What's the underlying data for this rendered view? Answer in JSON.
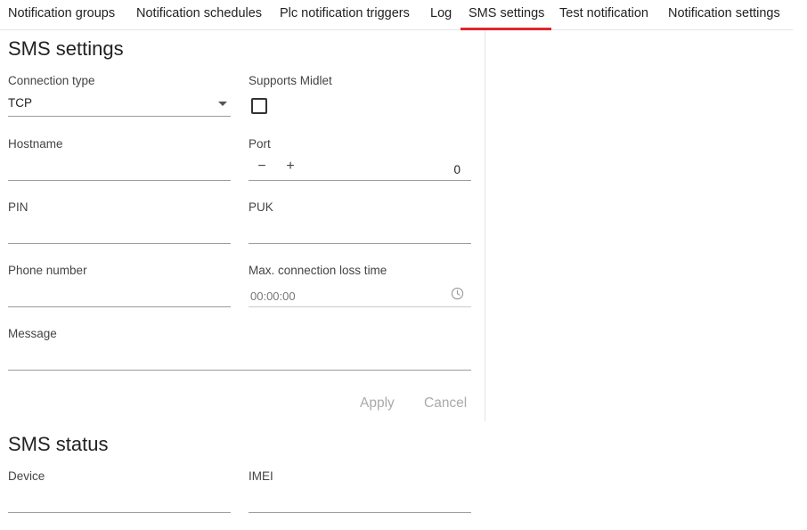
{
  "tabs": [
    {
      "label": "Notification groups"
    },
    {
      "label": "Notification schedules"
    },
    {
      "label": "Plc notification triggers"
    },
    {
      "label": "Log"
    },
    {
      "label": "SMS settings",
      "active": true
    },
    {
      "label": "Test notification"
    },
    {
      "label": "Notification settings"
    }
  ],
  "sms_settings": {
    "title": "SMS settings",
    "connection_type": {
      "label": "Connection type",
      "value": "TCP"
    },
    "supports_midlet": {
      "label": "Supports Midlet",
      "checked": false
    },
    "hostname": {
      "label": "Hostname",
      "value": ""
    },
    "port": {
      "label": "Port",
      "value": "0",
      "decrement": "−",
      "increment": "+"
    },
    "pin": {
      "label": "PIN",
      "value": ""
    },
    "puk": {
      "label": "PUK",
      "value": ""
    },
    "phone_number": {
      "label": "Phone number",
      "value": ""
    },
    "max_connection_loss_time": {
      "label": "Max. connection loss time",
      "placeholder": "00:00:00"
    },
    "message": {
      "label": "Message",
      "value": ""
    },
    "apply_label": "Apply",
    "cancel_label": "Cancel"
  },
  "sms_status": {
    "title": "SMS status",
    "device": {
      "label": "Device",
      "value": ""
    },
    "imei": {
      "label": "IMEI",
      "value": ""
    }
  },
  "colors": {
    "accent": "#e3242b",
    "disabled_text": "#aaaaaa",
    "underline": "#9a9a9a"
  },
  "icons": {
    "select": "chevron-down-icon",
    "time": "clock-icon",
    "checkbox": "checkbox-unchecked-icon"
  }
}
